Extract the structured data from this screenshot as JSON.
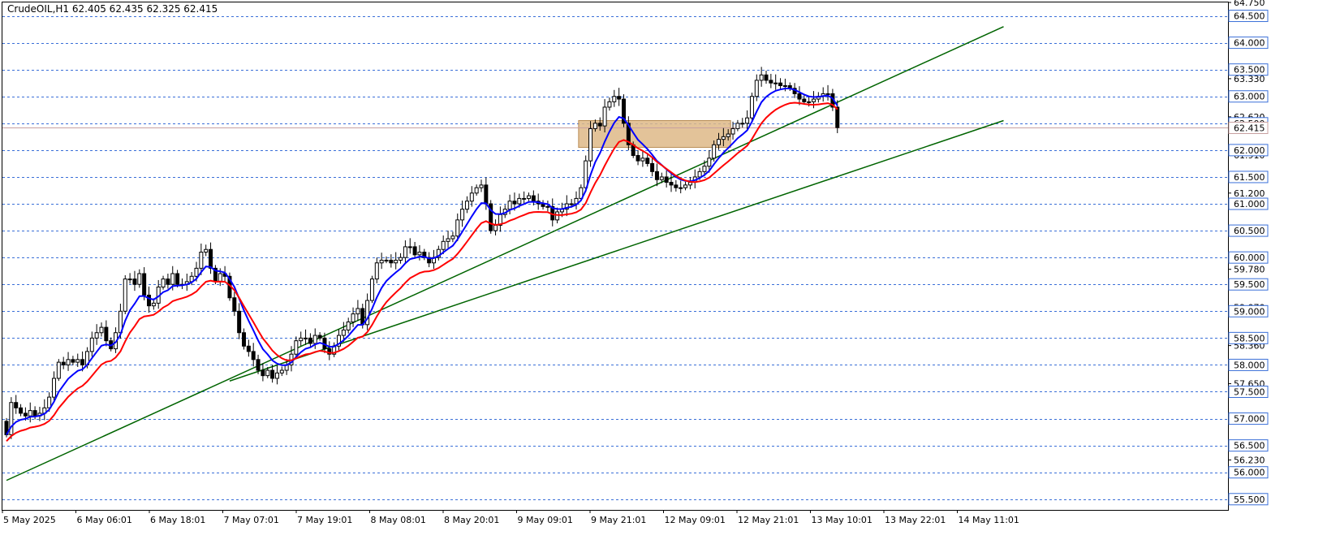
{
  "chart_title": "CrudeOIL,H1  62.405 62.435 62.325 62.415",
  "colors": {
    "background": "#ffffff",
    "grid": "#3a6fd8",
    "ma_fast": "#0000ff",
    "ma_slow": "#ff0000",
    "trendline": "#006400",
    "zone_fill": "#deb887",
    "current_price_line": "#c8a0a0",
    "price_tag_bg": "#ffffff",
    "candle_bull": "#ffffff",
    "candle_bear": "#000000"
  },
  "chart_data": {
    "type": "candlestick",
    "symbol": "CrudeOIL",
    "timeframe": "H1",
    "ohlc_header": {
      "open": 62.405,
      "high": 62.435,
      "low": 62.325,
      "close": 62.415
    },
    "ylim": [
      55.3,
      64.75
    ],
    "grid_levels": [
      55.5,
      56.0,
      56.5,
      57.0,
      57.5,
      58.0,
      58.5,
      59.0,
      59.5,
      60.0,
      60.5,
      61.0,
      61.5,
      62.0,
      62.5,
      63.0,
      63.5,
      64.0,
      64.5
    ],
    "price_tags": [
      "55.500",
      "56.000",
      "56.500",
      "57.000",
      "57.500",
      "58.000",
      "58.500",
      "59.000",
      "59.500",
      "60.000",
      "60.500",
      "61.000",
      "61.500",
      "62.000",
      "62.500",
      "63.000",
      "63.500",
      "64.000",
      "64.500"
    ],
    "axis_ticks": [
      {
        "value": 64.75,
        "label": "64.750"
      },
      {
        "value": 63.33,
        "label": "63.330"
      },
      {
        "value": 62.62,
        "label": "62.620"
      },
      {
        "value": 61.91,
        "label": "61.910"
      },
      {
        "value": 61.2,
        "label": "61.200"
      },
      {
        "value": 59.78,
        "label": "59.780"
      },
      {
        "value": 59.07,
        "label": "59.070"
      },
      {
        "value": 58.36,
        "label": "58.360"
      },
      {
        "value": 57.65,
        "label": "57.650"
      },
      {
        "value": 56.23,
        "label": "56.230"
      }
    ],
    "current_price": 62.415,
    "current_price_label": "62.415",
    "x_labels": [
      "5 May 2025",
      "6 May 06:01",
      "6 May 18:01",
      "7 May 07:01",
      "7 May 19:01",
      "8 May 08:01",
      "8 May 20:01",
      "9 May 09:01",
      "9 May 21:01",
      "12 May 09:01",
      "12 May 21:01",
      "13 May 10:01",
      "13 May 22:01",
      "14 May 11:01"
    ],
    "candles_close": [
      56.7,
      57.3,
      57.2,
      57.1,
      57.05,
      57.15,
      57.05,
      57.1,
      57.2,
      57.4,
      57.75,
      58.05,
      58.0,
      58.1,
      58.05,
      58.1,
      58.0,
      58.25,
      58.5,
      58.6,
      58.7,
      58.45,
      58.3,
      58.6,
      59.0,
      59.6,
      59.6,
      59.5,
      59.7,
      59.3,
      59.1,
      59.15,
      59.45,
      59.6,
      59.5,
      59.7,
      59.5,
      59.5,
      59.55,
      59.65,
      59.8,
      60.1,
      60.15,
      59.8,
      59.55,
      59.7,
      59.65,
      59.25,
      59.0,
      58.6,
      58.35,
      58.25,
      58.1,
      57.9,
      57.8,
      57.9,
      57.75,
      57.85,
      57.9,
      58.0,
      58.2,
      58.45,
      58.5,
      58.5,
      58.4,
      58.55,
      58.5,
      58.3,
      58.2,
      58.35,
      58.55,
      58.65,
      58.8,
      58.95,
      59.05,
      58.75,
      59.2,
      59.6,
      59.9,
      59.95,
      59.95,
      59.9,
      59.95,
      60.0,
      60.2,
      60.2,
      60.05,
      60.1,
      60.0,
      59.9,
      60.0,
      60.15,
      60.3,
      60.35,
      60.4,
      60.7,
      60.9,
      61.05,
      61.2,
      61.3,
      61.35,
      61.0,
      60.5,
      60.6,
      60.8,
      60.9,
      61.05,
      61.0,
      61.1,
      61.1,
      61.15,
      61.05,
      61.0,
      60.95,
      60.95,
      60.7,
      60.85,
      60.9,
      61.0,
      61.0,
      61.1,
      61.3,
      61.8,
      62.4,
      62.5,
      62.45,
      62.8,
      62.9,
      63.0,
      62.95,
      62.5,
      62.1,
      61.9,
      61.8,
      61.85,
      61.75,
      61.6,
      61.45,
      61.5,
      61.4,
      61.35,
      61.3,
      61.3,
      61.35,
      61.4,
      61.5,
      61.6,
      61.7,
      61.85,
      62.1,
      62.2,
      62.25,
      62.3,
      62.4,
      62.5,
      62.5,
      62.6,
      63.0,
      63.3,
      63.4,
      63.3,
      63.25,
      63.25,
      63.2,
      63.2,
      63.15,
      63.05,
      62.95,
      62.9,
      62.9,
      62.95,
      63.0,
      63.05,
      63.05,
      62.8,
      62.42
    ],
    "series": [
      {
        "name": "",
        "type": "moving-average",
        "color": "#0000ff"
      },
      {
        "name": "",
        "type": "moving-average",
        "color": "#ff0000"
      }
    ],
    "trendlines": [
      {
        "from": {
          "bar": 0,
          "price": 55.85
        },
        "to": {
          "bar": 210,
          "price": 64.3
        }
      },
      {
        "from": {
          "bar": 47,
          "price": 57.7
        },
        "to": {
          "bar": 210,
          "price": 62.55
        }
      }
    ],
    "zone": {
      "bar_from": 121,
      "bar_to": 152,
      "price_low": 62.05,
      "price_high": 62.55
    },
    "grid": true,
    "legend": "none"
  }
}
